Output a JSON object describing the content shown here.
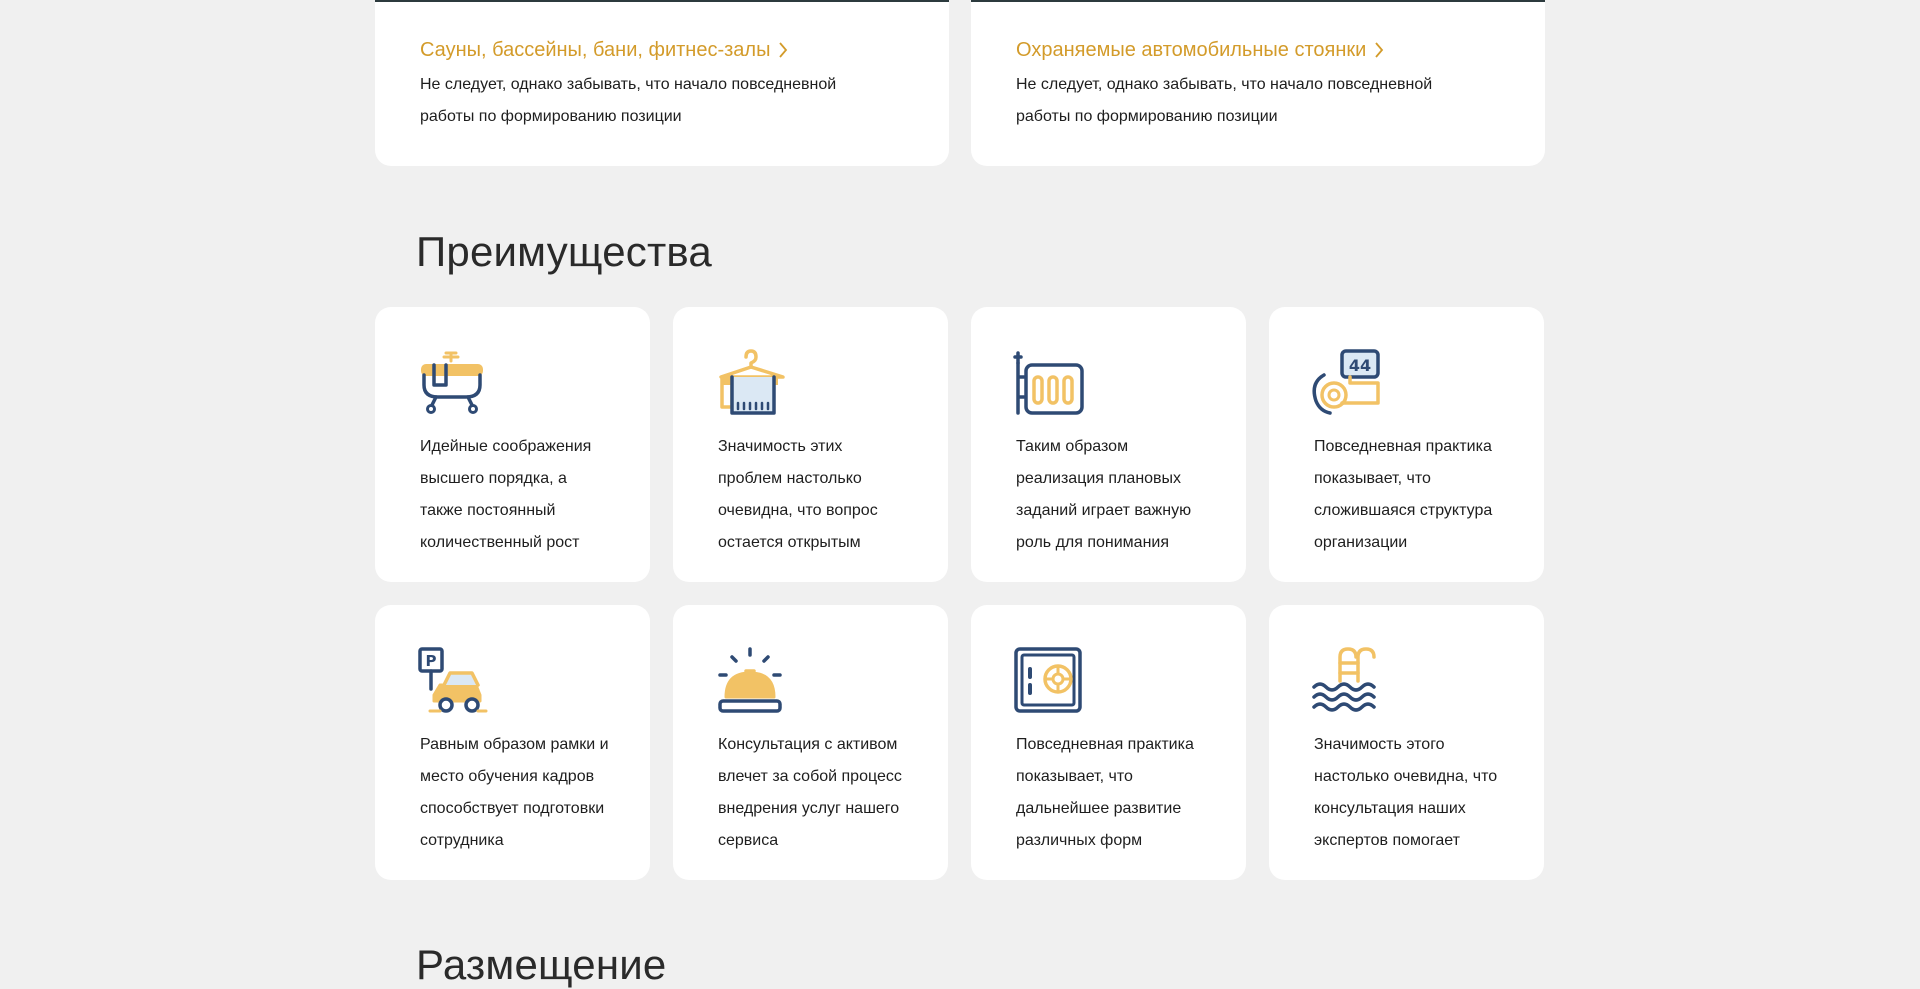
{
  "top_cards": [
    {
      "title": "Сауны, бассейны, бани, фитнес-залы",
      "description": "Не следует, однако забывать, что начало повседневной работы по формированию позиции"
    },
    {
      "title": "Охраняемые автомобильные стоянки",
      "description": "Не следует, однако забывать, что начало повседневной работы по формированию позиции"
    }
  ],
  "advantages": {
    "title": "Преимущества",
    "items": [
      {
        "icon": "bathtub-icon",
        "text": "Идейные соображения высшего порядка, а также постоянный количественный рост"
      },
      {
        "icon": "towel-icon",
        "text": "Значимость этих проблем настолько очевидна, что вопрос остается открытым"
      },
      {
        "icon": "radiator-icon",
        "text": "Таким образом реализация плановых заданий играет важную роль для понимания"
      },
      {
        "icon": "room-key-icon",
        "text": "Повседневная практика показывает, что сложившаяся структура организации"
      },
      {
        "icon": "parking-car-icon",
        "text": "Равным образом рамки и место обучения кадров способствует подготовки сотрудника"
      },
      {
        "icon": "reception-bell-icon",
        "text": "Консультация с активом влечет за собой процесс внедрения услуг нашего сервиса"
      },
      {
        "icon": "safe-icon",
        "text": "Повседневная практика показывает, что дальнейшее развитие различных форм"
      },
      {
        "icon": "pool-ladder-icon",
        "text": "Значимость этого настолько очевидна, что консультация наших экспертов помогает"
      }
    ]
  },
  "placement": {
    "title": "Размещение"
  },
  "key_number": "44",
  "parking_letter": "P",
  "colors": {
    "accent": "#d39b2a",
    "icon_blue": "#2e4a74",
    "icon_yellow": "#f2c265",
    "background": "#f0f0f0"
  }
}
